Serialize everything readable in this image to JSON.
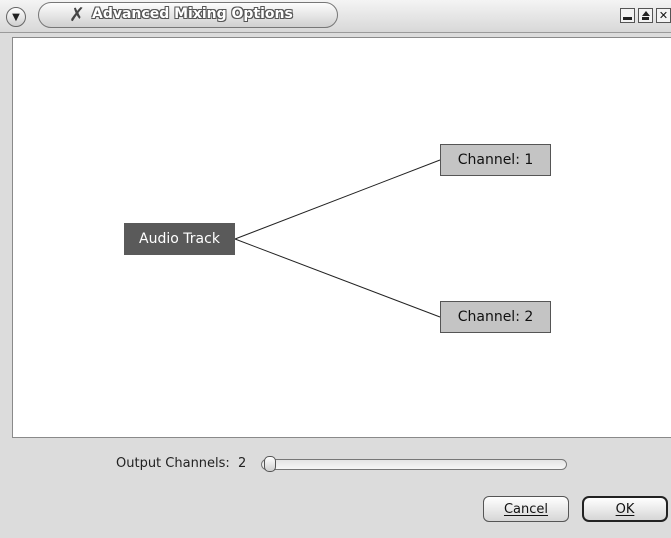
{
  "window": {
    "title": "Advanced Mixing Options",
    "menu_icon": "chevron-down-icon",
    "app_icon": "tools-x-icon",
    "controls": [
      "minimize",
      "maximize",
      "close"
    ],
    "close_glyph": "✕"
  },
  "graph": {
    "source": {
      "label": "Audio Track",
      "color": "#5a5a5a"
    },
    "channels": [
      {
        "label": "Channel:  1",
        "color": "#c4c4c4"
      },
      {
        "label": "Channel:  2",
        "color": "#c4c4c4"
      }
    ]
  },
  "output_channels": {
    "label": "Output Channels:",
    "value": "2",
    "slider_fraction": 0.0
  },
  "buttons": {
    "cancel": "Cancel",
    "ok": "OK"
  }
}
